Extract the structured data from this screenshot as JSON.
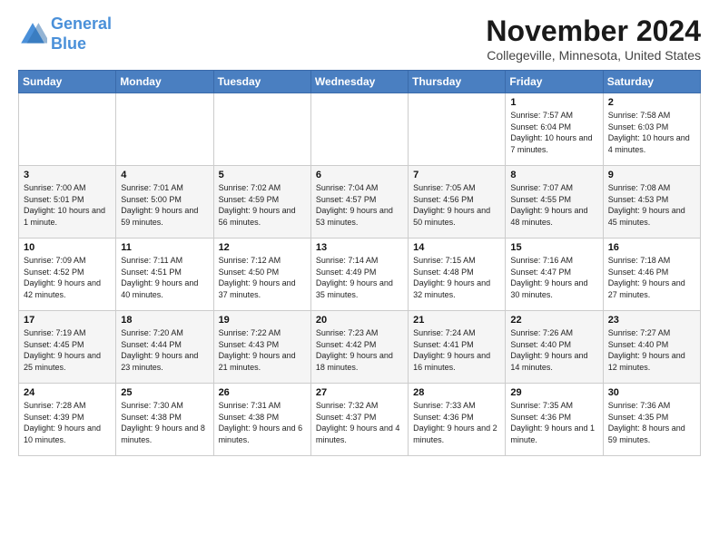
{
  "header": {
    "logo_line1": "General",
    "logo_line2": "Blue",
    "month": "November 2024",
    "location": "Collegeville, Minnesota, United States"
  },
  "days_of_week": [
    "Sunday",
    "Monday",
    "Tuesday",
    "Wednesday",
    "Thursday",
    "Friday",
    "Saturday"
  ],
  "weeks": [
    [
      {
        "day": "",
        "info": ""
      },
      {
        "day": "",
        "info": ""
      },
      {
        "day": "",
        "info": ""
      },
      {
        "day": "",
        "info": ""
      },
      {
        "day": "",
        "info": ""
      },
      {
        "day": "1",
        "info": "Sunrise: 7:57 AM\nSunset: 6:04 PM\nDaylight: 10 hours and 7 minutes."
      },
      {
        "day": "2",
        "info": "Sunrise: 7:58 AM\nSunset: 6:03 PM\nDaylight: 10 hours and 4 minutes."
      }
    ],
    [
      {
        "day": "3",
        "info": "Sunrise: 7:00 AM\nSunset: 5:01 PM\nDaylight: 10 hours and 1 minute."
      },
      {
        "day": "4",
        "info": "Sunrise: 7:01 AM\nSunset: 5:00 PM\nDaylight: 9 hours and 59 minutes."
      },
      {
        "day": "5",
        "info": "Sunrise: 7:02 AM\nSunset: 4:59 PM\nDaylight: 9 hours and 56 minutes."
      },
      {
        "day": "6",
        "info": "Sunrise: 7:04 AM\nSunset: 4:57 PM\nDaylight: 9 hours and 53 minutes."
      },
      {
        "day": "7",
        "info": "Sunrise: 7:05 AM\nSunset: 4:56 PM\nDaylight: 9 hours and 50 minutes."
      },
      {
        "day": "8",
        "info": "Sunrise: 7:07 AM\nSunset: 4:55 PM\nDaylight: 9 hours and 48 minutes."
      },
      {
        "day": "9",
        "info": "Sunrise: 7:08 AM\nSunset: 4:53 PM\nDaylight: 9 hours and 45 minutes."
      }
    ],
    [
      {
        "day": "10",
        "info": "Sunrise: 7:09 AM\nSunset: 4:52 PM\nDaylight: 9 hours and 42 minutes."
      },
      {
        "day": "11",
        "info": "Sunrise: 7:11 AM\nSunset: 4:51 PM\nDaylight: 9 hours and 40 minutes."
      },
      {
        "day": "12",
        "info": "Sunrise: 7:12 AM\nSunset: 4:50 PM\nDaylight: 9 hours and 37 minutes."
      },
      {
        "day": "13",
        "info": "Sunrise: 7:14 AM\nSunset: 4:49 PM\nDaylight: 9 hours and 35 minutes."
      },
      {
        "day": "14",
        "info": "Sunrise: 7:15 AM\nSunset: 4:48 PM\nDaylight: 9 hours and 32 minutes."
      },
      {
        "day": "15",
        "info": "Sunrise: 7:16 AM\nSunset: 4:47 PM\nDaylight: 9 hours and 30 minutes."
      },
      {
        "day": "16",
        "info": "Sunrise: 7:18 AM\nSunset: 4:46 PM\nDaylight: 9 hours and 27 minutes."
      }
    ],
    [
      {
        "day": "17",
        "info": "Sunrise: 7:19 AM\nSunset: 4:45 PM\nDaylight: 9 hours and 25 minutes."
      },
      {
        "day": "18",
        "info": "Sunrise: 7:20 AM\nSunset: 4:44 PM\nDaylight: 9 hours and 23 minutes."
      },
      {
        "day": "19",
        "info": "Sunrise: 7:22 AM\nSunset: 4:43 PM\nDaylight: 9 hours and 21 minutes."
      },
      {
        "day": "20",
        "info": "Sunrise: 7:23 AM\nSunset: 4:42 PM\nDaylight: 9 hours and 18 minutes."
      },
      {
        "day": "21",
        "info": "Sunrise: 7:24 AM\nSunset: 4:41 PM\nDaylight: 9 hours and 16 minutes."
      },
      {
        "day": "22",
        "info": "Sunrise: 7:26 AM\nSunset: 4:40 PM\nDaylight: 9 hours and 14 minutes."
      },
      {
        "day": "23",
        "info": "Sunrise: 7:27 AM\nSunset: 4:40 PM\nDaylight: 9 hours and 12 minutes."
      }
    ],
    [
      {
        "day": "24",
        "info": "Sunrise: 7:28 AM\nSunset: 4:39 PM\nDaylight: 9 hours and 10 minutes."
      },
      {
        "day": "25",
        "info": "Sunrise: 7:30 AM\nSunset: 4:38 PM\nDaylight: 9 hours and 8 minutes."
      },
      {
        "day": "26",
        "info": "Sunrise: 7:31 AM\nSunset: 4:38 PM\nDaylight: 9 hours and 6 minutes."
      },
      {
        "day": "27",
        "info": "Sunrise: 7:32 AM\nSunset: 4:37 PM\nDaylight: 9 hours and 4 minutes."
      },
      {
        "day": "28",
        "info": "Sunrise: 7:33 AM\nSunset: 4:36 PM\nDaylight: 9 hours and 2 minutes."
      },
      {
        "day": "29",
        "info": "Sunrise: 7:35 AM\nSunset: 4:36 PM\nDaylight: 9 hours and 1 minute."
      },
      {
        "day": "30",
        "info": "Sunrise: 7:36 AM\nSunset: 4:35 PM\nDaylight: 8 hours and 59 minutes."
      }
    ]
  ]
}
